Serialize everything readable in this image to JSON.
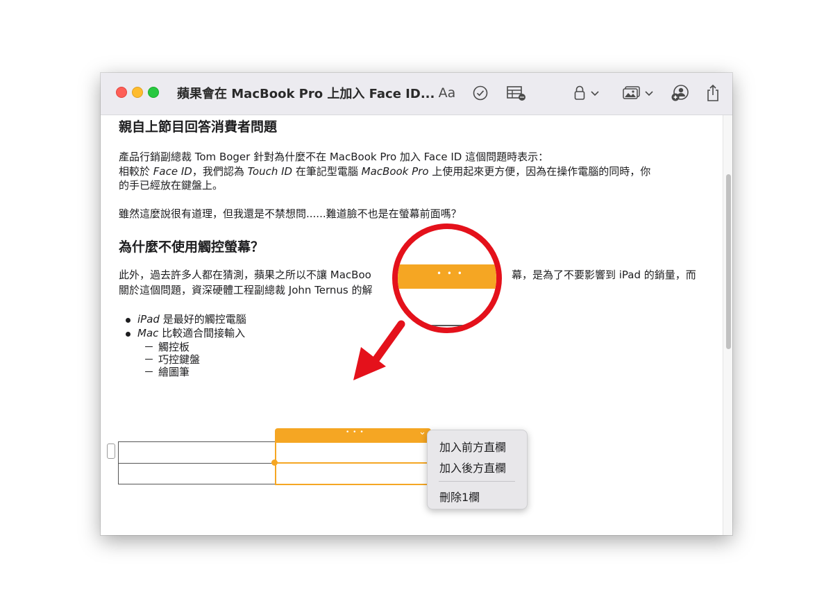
{
  "window": {
    "title": "蘋果會在 MacBook Pro 上加入 Face ID...",
    "toolbar": {
      "format_label": "Aa",
      "checklist_icon": "checkmark-circle-icon",
      "table_icon": "table-icon",
      "lock_icon": "lock-icon",
      "media_icon": "photo-icon",
      "collab_icon": "add-people-icon",
      "share_icon": "share-icon"
    }
  },
  "article": {
    "heading1": "親自上節目回答消費者問題",
    "para1_line1": "產品行銷副總裁 Tom Boger 針對為什麼不在 MacBook Pro 加入 Face ID 這個問題時表示：",
    "para1_line2_parts": [
      "相較於 ",
      "Face ID",
      "，我們認為 ",
      "Touch ID",
      " 在筆記型電腦  ",
      "MacBook Pro",
      " 上使用起來更方便，因為在操作電腦的同時，你"
    ],
    "para1_line3": "的手已經放在鍵盤上。",
    "para2": "雖然這麼說很有道理，但我還是不禁想問......難道臉不也是在螢幕前面嗎？",
    "heading2": "為什麼不使用觸控螢幕？",
    "para3_line1_left": "此外，過去許多人都在猜測，蘋果之所以不讓 MacBoo",
    "para3_line1_right": "幕，是為了不要影響到 iPad 的銷量，而",
    "para3_line2": "關於這個問題，資深硬體工程副總裁 John Ternus 的解",
    "bullets": [
      {
        "italic": "iPad",
        "text": " 是最好的觸控電腦"
      },
      {
        "italic": "Mac",
        "text": " 比較適合間接輸入"
      }
    ],
    "sub_bullets": [
      "觸控板",
      "巧控鍵盤",
      "繪圖筆"
    ],
    "dash": "－"
  },
  "table_column_bar": {
    "dots": "• • •",
    "chevron": "⌄"
  },
  "context_menu": {
    "items": [
      "加入前方直欄",
      "加入後方直欄"
    ],
    "delete_item": "刪除1欄"
  },
  "callout": {
    "magnifier_dots": "• • •",
    "accent_color": "#e4111b",
    "highlight_color": "#f5a623"
  }
}
